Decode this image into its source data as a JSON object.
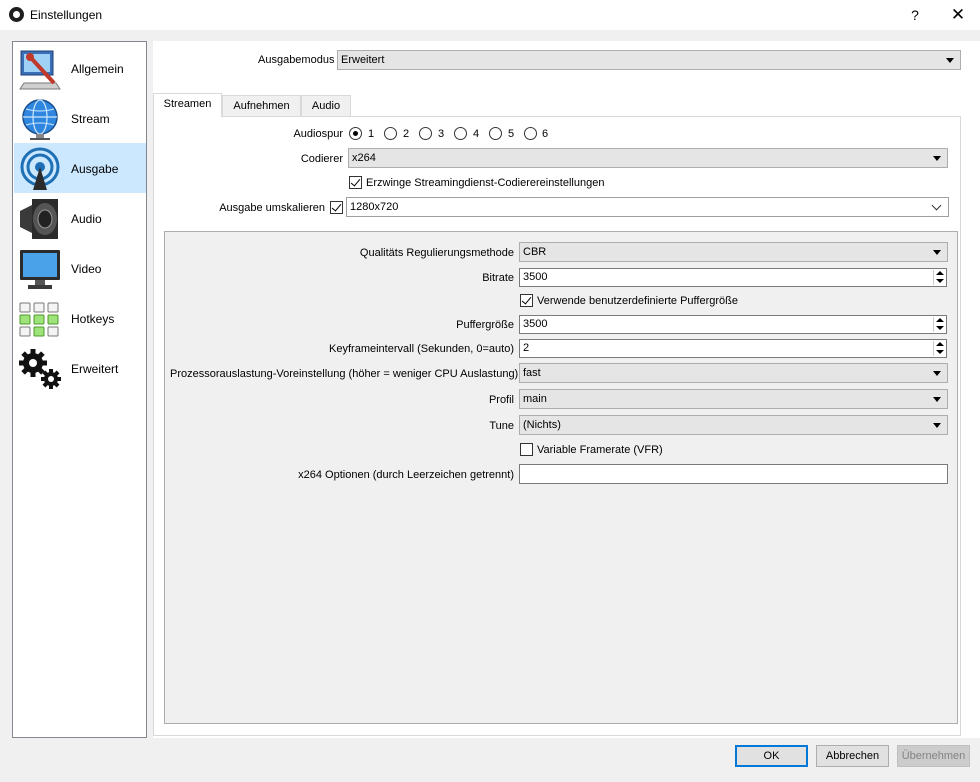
{
  "window": {
    "title": "Einstellungen",
    "help_label": "?",
    "close_label": "✕"
  },
  "sidebar": {
    "items": [
      {
        "label": "Allgemein",
        "icon": "general-icon"
      },
      {
        "label": "Stream",
        "icon": "globe-icon"
      },
      {
        "label": "Ausgabe",
        "icon": "broadcast-icon",
        "active": true
      },
      {
        "label": "Audio",
        "icon": "speaker-icon"
      },
      {
        "label": "Video",
        "icon": "monitor-icon"
      },
      {
        "label": "Hotkeys",
        "icon": "keyboard-icon"
      },
      {
        "label": "Erweitert",
        "icon": "gears-icon"
      }
    ]
  },
  "output_mode": {
    "label": "Ausgabemodus",
    "value": "Erweitert"
  },
  "tabs": [
    {
      "label": "Streamen",
      "active": true
    },
    {
      "label": "Aufnehmen"
    },
    {
      "label": "Audio"
    }
  ],
  "streaming": {
    "audio_track_label": "Audiospur",
    "audio_tracks": [
      "1",
      "2",
      "3",
      "4",
      "5",
      "6"
    ],
    "audio_track_selected": "1",
    "encoder_label": "Codierer",
    "encoder_value": "x264",
    "enforce_label": "Erzwinge Streamingdienst-Codierereinstellungen",
    "enforce_checked": true,
    "rescale_label": "Ausgabe umskalieren",
    "rescale_checked": true,
    "rescale_value": "1280x720"
  },
  "encoder_settings": {
    "rate_control_label": "Qualitäts Regulierungsmethode",
    "rate_control_value": "CBR",
    "bitrate_label": "Bitrate",
    "bitrate_value": "3500",
    "custom_buffer_label": "Verwende benutzerdefinierte Puffergröße",
    "custom_buffer_checked": true,
    "buffer_label": "Puffergröße",
    "buffer_value": "3500",
    "keyframe_label": "Keyframeintervall (Sekunden, 0=auto)",
    "keyframe_value": "2",
    "preset_label": "Prozessorauslastung-Voreinstellung (höher = weniger CPU Auslastung)",
    "preset_value": "fast",
    "profile_label": "Profil",
    "profile_value": "main",
    "tune_label": "Tune",
    "tune_value": "(Nichts)",
    "vfr_label": "Variable Framerate (VFR)",
    "vfr_checked": false,
    "x264_opts_label": "x264 Optionen (durch Leerzeichen getrennt)",
    "x264_opts_value": ""
  },
  "buttons": {
    "ok": "OK",
    "cancel": "Abbrechen",
    "apply": "Übernehmen"
  }
}
